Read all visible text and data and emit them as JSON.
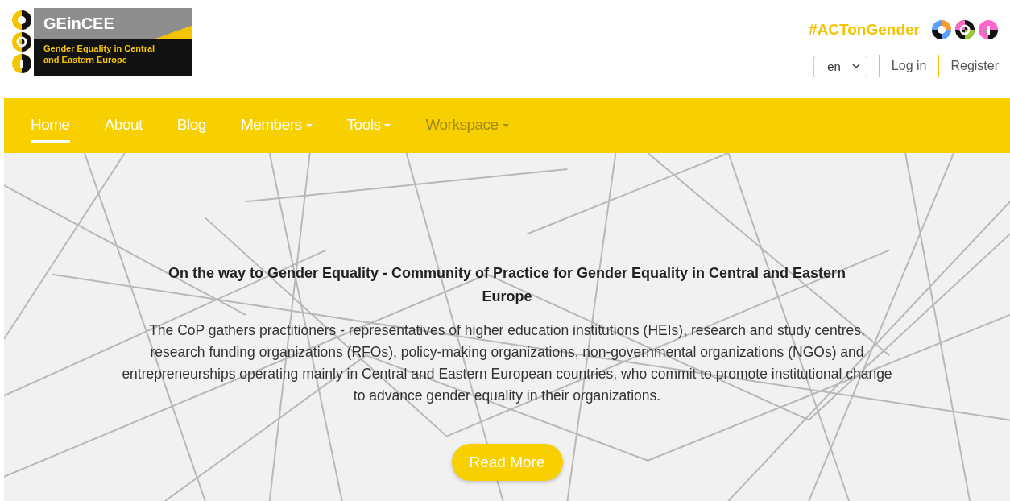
{
  "logo": {
    "name": "GEinCEE",
    "tagline_lines": [
      "Gender Equality in Central",
      "and Eastern Europe"
    ]
  },
  "hashtag": "#ACTonGender",
  "language": {
    "value": "en"
  },
  "account_links": [
    "Log in",
    "Register"
  ],
  "nav": [
    {
      "label": "Home",
      "selected": true,
      "dropdown": false,
      "disabled": false
    },
    {
      "label": "About",
      "selected": false,
      "dropdown": false,
      "disabled": false
    },
    {
      "label": "Blog",
      "selected": false,
      "dropdown": false,
      "disabled": false
    },
    {
      "label": "Members",
      "selected": false,
      "dropdown": true,
      "disabled": false
    },
    {
      "label": "Tools",
      "selected": false,
      "dropdown": true,
      "disabled": false
    },
    {
      "label": "Workspace",
      "selected": false,
      "dropdown": true,
      "disabled": true
    }
  ],
  "hero": {
    "title": "On the way to Gender Equality - Community of Practice for Gender Equality in Central and Eastern Europe",
    "text": "The CoP gathers practitioners - representatives of higher education institutions (HEIs), research and study centres, research funding organizations (RFOs), policy-making organizations, non-governmental organizations (NGOs) and entrepreneurships operating mainly in Central and Eastern European countries, who commit to promote institutional change to advance gender equality in their organizations.",
    "button": "Read More"
  }
}
